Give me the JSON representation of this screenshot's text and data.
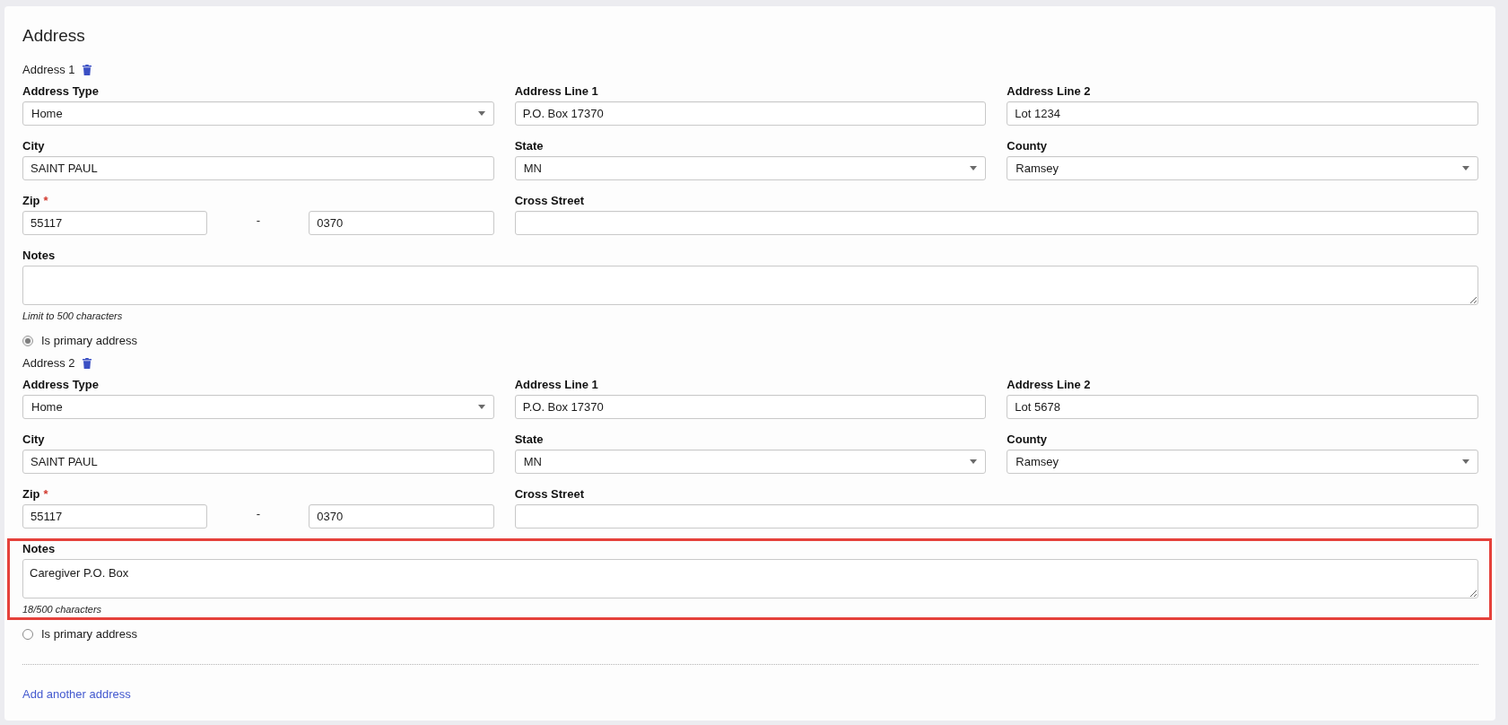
{
  "title": "Address",
  "addresses": [
    {
      "heading": "Address 1",
      "rows": [
        [
          {
            "kind": "select",
            "label": "Address Type",
            "value": "Home"
          },
          {
            "kind": "text",
            "label": "Address Line 1",
            "value": "P.O. Box 17370"
          },
          {
            "kind": "text",
            "label": "Address Line 2",
            "value": "Lot 1234"
          }
        ],
        [
          {
            "kind": "text",
            "label": "City",
            "value": "SAINT PAUL"
          },
          {
            "kind": "select",
            "label": "State",
            "value": "MN"
          },
          {
            "kind": "select",
            "label": "County",
            "value": "Ramsey"
          }
        ],
        [
          {
            "kind": "zip",
            "label": "Zip",
            "required_mark": "*",
            "value": "55117",
            "separator": "-",
            "extension": "0370"
          },
          {
            "kind": "text",
            "label": "Cross Street"
          }
        ]
      ],
      "notes": {
        "label": "Notes",
        "hint": "Limit to 500 characters",
        "highlighted": false
      },
      "primary": {
        "label": "Is primary address",
        "selected": true
      }
    },
    {
      "heading": "Address 2",
      "rows": [
        [
          {
            "kind": "select",
            "label": "Address Type",
            "value": "Home"
          },
          {
            "kind": "text",
            "label": "Address Line 1",
            "value": "P.O. Box 17370"
          },
          {
            "kind": "text",
            "label": "Address Line 2",
            "value": "Lot 5678"
          }
        ],
        [
          {
            "kind": "text",
            "label": "City",
            "value": "SAINT PAUL"
          },
          {
            "kind": "select",
            "label": "State",
            "value": "MN"
          },
          {
            "kind": "select",
            "label": "County",
            "value": "Ramsey"
          }
        ],
        [
          {
            "kind": "zip",
            "label": "Zip",
            "required_mark": "*",
            "value": "55117",
            "separator": "-",
            "extension": "0370"
          },
          {
            "kind": "text",
            "label": "Cross Street"
          }
        ]
      ],
      "notes": {
        "label": "Notes",
        "value": "Caregiver P.O. Box",
        "hint": "18/500 characters",
        "highlighted": true
      },
      "primary": {
        "label": "Is primary address",
        "selected": false
      }
    }
  ],
  "add_link": "Add another address"
}
